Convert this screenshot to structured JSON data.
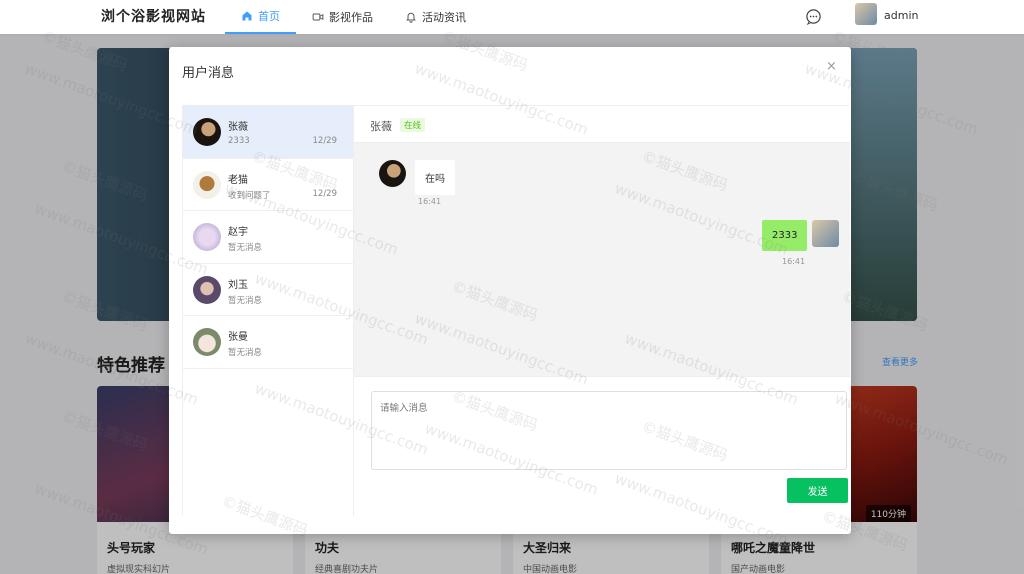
{
  "site": {
    "logo": "浏个浴影视网站",
    "username": "admin"
  },
  "nav": [
    {
      "label": "首页",
      "icon": "home-icon",
      "active": true
    },
    {
      "label": "影视作品",
      "icon": "video-icon",
      "active": false
    },
    {
      "label": "活动资讯",
      "icon": "bell-icon",
      "active": false
    }
  ],
  "section": {
    "title": "特色推荐",
    "more": "查看更多"
  },
  "cards": [
    {
      "title": "头号玩家",
      "desc": "虚拟现实科幻片"
    },
    {
      "title": "功夫",
      "desc": "经典喜剧功夫片"
    },
    {
      "title": "大圣归来",
      "desc": "中国动画电影"
    },
    {
      "title": "哪吒之魔童降世",
      "desc": "国产动画电影",
      "duration": "110分钟"
    }
  ],
  "dialog": {
    "title": "用户消息",
    "close": "×",
    "contacts": [
      {
        "name": "张薇",
        "last": "2333",
        "date": "12/29",
        "active": true
      },
      {
        "name": "老猫",
        "last": "收到问题了",
        "date": "12/29"
      },
      {
        "name": "赵宇",
        "last": "暂无消息",
        "date": ""
      },
      {
        "name": "刘玉",
        "last": "暂无消息",
        "date": ""
      },
      {
        "name": "张曼",
        "last": "暂无消息",
        "date": ""
      }
    ],
    "chat": {
      "name": "张薇",
      "status": "在线",
      "messages": [
        {
          "side": "left",
          "text": "在吗",
          "time": "16:41"
        },
        {
          "side": "right",
          "text": "2333",
          "time": "16:41"
        }
      ],
      "placeholder": "请输入消息",
      "send": "发送"
    }
  },
  "watermark": {
    "cn": "©猫头鹰源码",
    "en": "www.maotouyingcc.com"
  },
  "colors": {
    "accent": "#409eff",
    "send": "#07c160",
    "bubble_self": "#95ec69",
    "online": "#52c41a"
  }
}
